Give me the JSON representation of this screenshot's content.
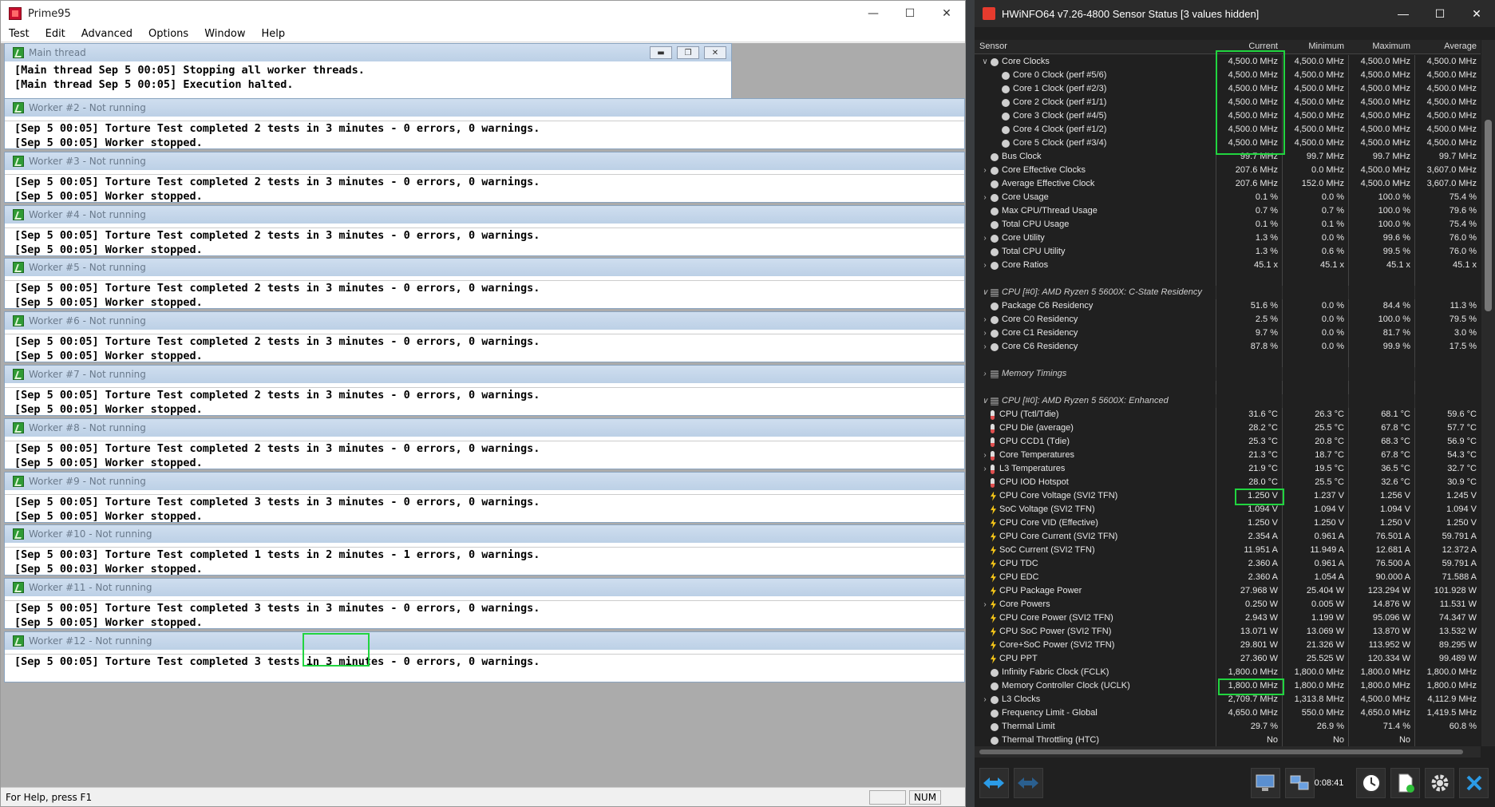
{
  "prime95": {
    "title": "Prime95",
    "menu": [
      "Test",
      "Edit",
      "Advanced",
      "Options",
      "Window",
      "Help"
    ],
    "main_thread": {
      "title": "Main thread",
      "lines": [
        "[Main thread Sep 5 00:05] Stopping all worker threads.",
        "[Main thread Sep 5 00:05] Execution halted."
      ]
    },
    "workers": [
      {
        "title": "Worker #2 - Not running",
        "line1": "[Sep 5 00:05] Torture Test completed 2 tests in 3 minutes - 0 errors, 0 warnings.",
        "line2": "[Sep 5 00:05] Worker stopped."
      },
      {
        "title": "Worker #3 - Not running",
        "line1": "[Sep 5 00:05] Torture Test completed 2 tests in 3 minutes - 0 errors, 0 warnings.",
        "line2": "[Sep 5 00:05] Worker stopped."
      },
      {
        "title": "Worker #4 - Not running",
        "line1": "[Sep 5 00:05] Torture Test completed 2 tests in 3 minutes - 0 errors, 0 warnings.",
        "line2": "[Sep 5 00:05] Worker stopped."
      },
      {
        "title": "Worker #5 - Not running",
        "line1": "[Sep 5 00:05] Torture Test completed 2 tests in 3 minutes - 0 errors, 0 warnings.",
        "line2": "[Sep 5 00:05] Worker stopped."
      },
      {
        "title": "Worker #6 - Not running",
        "line1": "[Sep 5 00:05] Torture Test completed 2 tests in 3 minutes - 0 errors, 0 warnings.",
        "line2": "[Sep 5 00:05] Worker stopped."
      },
      {
        "title": "Worker #7 - Not running",
        "line1": "[Sep 5 00:05] Torture Test completed 2 tests in 3 minutes - 0 errors, 0 warnings.",
        "line2": "[Sep 5 00:05] Worker stopped."
      },
      {
        "title": "Worker #8 - Not running",
        "line1": "[Sep 5 00:05] Torture Test completed 2 tests in 3 minutes - 0 errors, 0 warnings.",
        "line2": "[Sep 5 00:05] Worker stopped."
      },
      {
        "title": "Worker #9 - Not running",
        "line1": "[Sep 5 00:05] Torture Test completed 3 tests in 3 minutes - 0 errors, 0 warnings.",
        "line2": "[Sep 5 00:05] Worker stopped."
      },
      {
        "title": "Worker #10 - Not running",
        "line1": "[Sep 5 00:03] Torture Test completed 1 tests in 2 minutes - 1 errors, 0 warnings.",
        "line2": "[Sep 5 00:03] Worker stopped."
      },
      {
        "title": "Worker #11 - Not running",
        "line1": "[Sep 5 00:05] Torture Test completed 3 tests in 3 minutes - 0 errors, 0 warnings.",
        "line2": "[Sep 5 00:05] Worker stopped."
      },
      {
        "title": "Worker #12 - Not running",
        "line1": "[Sep 5 00:05] Torture Test completed 3 tests in 3 minutes - 0 errors, 0 warnings.",
        "line2": ""
      }
    ],
    "status": {
      "help": "For Help, press F1",
      "num": "NUM"
    }
  },
  "hwinfo": {
    "title": "HWiNFO64 v7.26-4800 Sensor Status [3 values hidden]",
    "columns": {
      "sensor": "Sensor",
      "current": "Current",
      "minimum": "Minimum",
      "maximum": "Maximum",
      "average": "Average"
    },
    "timer": "0:08:41",
    "rows": [
      {
        "n": "Core Clocks",
        "c": "4,500.0 MHz",
        "mi": "4,500.0 MHz",
        "ma": "4,500.0 MHz",
        "a": "4,500.0 MHz",
        "lvl": 1,
        "exp": "v",
        "ic": "clock"
      },
      {
        "n": "Core 0 Clock (perf #5/6)",
        "c": "4,500.0 MHz",
        "mi": "4,500.0 MHz",
        "ma": "4,500.0 MHz",
        "a": "4,500.0 MHz",
        "lvl": 2,
        "ic": "clock"
      },
      {
        "n": "Core 1 Clock (perf #2/3)",
        "c": "4,500.0 MHz",
        "mi": "4,500.0 MHz",
        "ma": "4,500.0 MHz",
        "a": "4,500.0 MHz",
        "lvl": 2,
        "ic": "clock"
      },
      {
        "n": "Core 2 Clock (perf #1/1)",
        "c": "4,500.0 MHz",
        "mi": "4,500.0 MHz",
        "ma": "4,500.0 MHz",
        "a": "4,500.0 MHz",
        "lvl": 2,
        "ic": "clock"
      },
      {
        "n": "Core 3 Clock (perf #4/5)",
        "c": "4,500.0 MHz",
        "mi": "4,500.0 MHz",
        "ma": "4,500.0 MHz",
        "a": "4,500.0 MHz",
        "lvl": 2,
        "ic": "clock"
      },
      {
        "n": "Core 4 Clock (perf #1/2)",
        "c": "4,500.0 MHz",
        "mi": "4,500.0 MHz",
        "ma": "4,500.0 MHz",
        "a": "4,500.0 MHz",
        "lvl": 2,
        "ic": "clock"
      },
      {
        "n": "Core 5 Clock (perf #3/4)",
        "c": "4,500.0 MHz",
        "mi": "4,500.0 MHz",
        "ma": "4,500.0 MHz",
        "a": "4,500.0 MHz",
        "lvl": 2,
        "ic": "clock"
      },
      {
        "n": "Bus Clock",
        "c": "99.7 MHz",
        "mi": "99.7 MHz",
        "ma": "99.7 MHz",
        "a": "99.7 MHz",
        "lvl": 0,
        "ic": "clock"
      },
      {
        "n": "Core Effective Clocks",
        "c": "207.6 MHz",
        "mi": "0.0 MHz",
        "ma": "4,500.0 MHz",
        "a": "3,607.0 MHz",
        "lvl": 1,
        "exp": ">",
        "ic": "clock"
      },
      {
        "n": "Average Effective Clock",
        "c": "207.6 MHz",
        "mi": "152.0 MHz",
        "ma": "4,500.0 MHz",
        "a": "3,607.0 MHz",
        "lvl": 0,
        "ic": "clock"
      },
      {
        "n": "Core Usage",
        "c": "0.1 %",
        "mi": "0.0 %",
        "ma": "100.0 %",
        "a": "75.4 %",
        "lvl": 1,
        "exp": ">",
        "ic": "clock"
      },
      {
        "n": "Max CPU/Thread Usage",
        "c": "0.7 %",
        "mi": "0.7 %",
        "ma": "100.0 %",
        "a": "79.6 %",
        "lvl": 0,
        "ic": "clock"
      },
      {
        "n": "Total CPU Usage",
        "c": "0.1 %",
        "mi": "0.1 %",
        "ma": "100.0 %",
        "a": "75.4 %",
        "lvl": 0,
        "ic": "clock"
      },
      {
        "n": "Core Utility",
        "c": "1.3 %",
        "mi": "0.0 %",
        "ma": "99.6 %",
        "a": "76.0 %",
        "lvl": 1,
        "exp": ">",
        "ic": "clock"
      },
      {
        "n": "Total CPU Utility",
        "c": "1.3 %",
        "mi": "0.6 %",
        "ma": "99.5 %",
        "a": "76.0 %",
        "lvl": 0,
        "ic": "clock"
      },
      {
        "n": "Core Ratios",
        "c": "45.1 x",
        "mi": "45.1 x",
        "ma": "45.1 x",
        "a": "45.1 x",
        "lvl": 1,
        "exp": ">",
        "ic": "clock"
      },
      {
        "n": "",
        "c": "",
        "mi": "",
        "ma": "",
        "a": "",
        "lvl": 0,
        "blank": true
      },
      {
        "n": "CPU [#0]: AMD Ryzen 5 5600X: C-State Residency",
        "c": "",
        "mi": "",
        "ma": "",
        "a": "",
        "lvl": 0,
        "group": true,
        "exp": "v"
      },
      {
        "n": "Package C6 Residency",
        "c": "51.6 %",
        "mi": "0.0 %",
        "ma": "84.4 %",
        "a": "11.3 %",
        "lvl": 0,
        "ic": "clock"
      },
      {
        "n": "Core C0 Residency",
        "c": "2.5 %",
        "mi": "0.0 %",
        "ma": "100.0 %",
        "a": "79.5 %",
        "lvl": 1,
        "exp": ">",
        "ic": "clock"
      },
      {
        "n": "Core C1 Residency",
        "c": "9.7 %",
        "mi": "0.0 %",
        "ma": "81.7 %",
        "a": "3.0 %",
        "lvl": 1,
        "exp": ">",
        "ic": "clock"
      },
      {
        "n": "Core C6 Residency",
        "c": "87.8 %",
        "mi": "0.0 %",
        "ma": "99.9 %",
        "a": "17.5 %",
        "lvl": 1,
        "exp": ">",
        "ic": "clock"
      },
      {
        "n": "",
        "c": "",
        "mi": "",
        "ma": "",
        "a": "",
        "lvl": 0,
        "blank": true
      },
      {
        "n": "Memory Timings",
        "c": "",
        "mi": "",
        "ma": "",
        "a": "",
        "lvl": 0,
        "group": true,
        "exp": ">"
      },
      {
        "n": "",
        "c": "",
        "mi": "",
        "ma": "",
        "a": "",
        "lvl": 0,
        "blank": true
      },
      {
        "n": "CPU [#0]: AMD Ryzen 5 5600X: Enhanced",
        "c": "",
        "mi": "",
        "ma": "",
        "a": "",
        "lvl": 0,
        "group": true,
        "exp": "v"
      },
      {
        "n": "CPU (Tctl/Tdie)",
        "c": "31.6 °C",
        "mi": "26.3 °C",
        "ma": "68.1 °C",
        "a": "59.6 °C",
        "lvl": 0,
        "ic": "temp"
      },
      {
        "n": "CPU Die (average)",
        "c": "28.2 °C",
        "mi": "25.5 °C",
        "ma": "67.8 °C",
        "a": "57.7 °C",
        "lvl": 0,
        "ic": "temp"
      },
      {
        "n": "CPU CCD1 (Tdie)",
        "c": "25.3 °C",
        "mi": "20.8 °C",
        "ma": "68.3 °C",
        "a": "56.9 °C",
        "lvl": 0,
        "ic": "temp"
      },
      {
        "n": "Core Temperatures",
        "c": "21.3 °C",
        "mi": "18.7 °C",
        "ma": "67.8 °C",
        "a": "54.3 °C",
        "lvl": 1,
        "exp": ">",
        "ic": "temp"
      },
      {
        "n": "L3 Temperatures",
        "c": "21.9 °C",
        "mi": "19.5 °C",
        "ma": "36.5 °C",
        "a": "32.7 °C",
        "lvl": 1,
        "exp": ">",
        "ic": "temp"
      },
      {
        "n": "CPU IOD Hotspot",
        "c": "28.0 °C",
        "mi": "25.5 °C",
        "ma": "32.6 °C",
        "a": "30.9 °C",
        "lvl": 0,
        "ic": "temp"
      },
      {
        "n": "CPU Core Voltage (SVI2 TFN)",
        "c": "1.250 V",
        "mi": "1.237 V",
        "ma": "1.256 V",
        "a": "1.245 V",
        "lvl": 0,
        "ic": "volt"
      },
      {
        "n": "SoC Voltage (SVI2 TFN)",
        "c": "1.094 V",
        "mi": "1.094 V",
        "ma": "1.094 V",
        "a": "1.094 V",
        "lvl": 0,
        "ic": "volt"
      },
      {
        "n": "CPU Core VID (Effective)",
        "c": "1.250 V",
        "mi": "1.250 V",
        "ma": "1.250 V",
        "a": "1.250 V",
        "lvl": 0,
        "ic": "volt"
      },
      {
        "n": "CPU Core Current (SVI2 TFN)",
        "c": "2.354 A",
        "mi": "0.961 A",
        "ma": "76.501 A",
        "a": "59.791 A",
        "lvl": 0,
        "ic": "volt"
      },
      {
        "n": "SoC Current (SVI2 TFN)",
        "c": "11.951 A",
        "mi": "11.949 A",
        "ma": "12.681 A",
        "a": "12.372 A",
        "lvl": 0,
        "ic": "volt"
      },
      {
        "n": "CPU TDC",
        "c": "2.360 A",
        "mi": "0.961 A",
        "ma": "76.500 A",
        "a": "59.791 A",
        "lvl": 0,
        "ic": "volt"
      },
      {
        "n": "CPU EDC",
        "c": "2.360 A",
        "mi": "1.054 A",
        "ma": "90.000 A",
        "a": "71.588 A",
        "lvl": 0,
        "ic": "volt"
      },
      {
        "n": "CPU Package Power",
        "c": "27.968 W",
        "mi": "25.404 W",
        "ma": "123.294 W",
        "a": "101.928 W",
        "lvl": 0,
        "ic": "volt"
      },
      {
        "n": "Core Powers",
        "c": "0.250 W",
        "mi": "0.005 W",
        "ma": "14.876 W",
        "a": "11.531 W",
        "lvl": 1,
        "exp": ">",
        "ic": "volt"
      },
      {
        "n": "CPU Core Power (SVI2 TFN)",
        "c": "2.943 W",
        "mi": "1.199 W",
        "ma": "95.096 W",
        "a": "74.347 W",
        "lvl": 0,
        "ic": "volt"
      },
      {
        "n": "CPU SoC Power (SVI2 TFN)",
        "c": "13.071 W",
        "mi": "13.069 W",
        "ma": "13.870 W",
        "a": "13.532 W",
        "lvl": 0,
        "ic": "volt"
      },
      {
        "n": "Core+SoC Power (SVI2 TFN)",
        "c": "29.801 W",
        "mi": "21.326 W",
        "ma": "113.952 W",
        "a": "89.295 W",
        "lvl": 0,
        "ic": "volt"
      },
      {
        "n": "CPU PPT",
        "c": "27.360 W",
        "mi": "25.525 W",
        "ma": "120.334 W",
        "a": "99.489 W",
        "lvl": 0,
        "ic": "volt"
      },
      {
        "n": "Infinity Fabric Clock (FCLK)",
        "c": "1,800.0 MHz",
        "mi": "1,800.0 MHz",
        "ma": "1,800.0 MHz",
        "a": "1,800.0 MHz",
        "lvl": 0,
        "ic": "clock"
      },
      {
        "n": "Memory Controller Clock (UCLK)",
        "c": "1,800.0 MHz",
        "mi": "1,800.0 MHz",
        "ma": "1,800.0 MHz",
        "a": "1,800.0 MHz",
        "lvl": 0,
        "ic": "clock"
      },
      {
        "n": "L3 Clocks",
        "c": "2,709.7 MHz",
        "mi": "1,313.8 MHz",
        "ma": "4,500.0 MHz",
        "a": "4,112.9 MHz",
        "lvl": 1,
        "exp": ">",
        "ic": "clock"
      },
      {
        "n": "Frequency Limit - Global",
        "c": "4,650.0 MHz",
        "mi": "550.0 MHz",
        "ma": "4,650.0 MHz",
        "a": "1,419.5 MHz",
        "lvl": 0,
        "ic": "clock"
      },
      {
        "n": "Thermal Limit",
        "c": "29.7 %",
        "mi": "26.9 %",
        "ma": "71.4 %",
        "a": "60.8 %",
        "lvl": 0,
        "ic": "clock"
      },
      {
        "n": "Thermal Throttling (HTC)",
        "c": "No",
        "mi": "No",
        "ma": "No",
        "a": "",
        "lvl": 0,
        "ic": "clock"
      }
    ]
  },
  "colors": {
    "highlight": "#21d43f",
    "hw_bg": "#202020",
    "prime_title_bg": "#cfdeef"
  }
}
